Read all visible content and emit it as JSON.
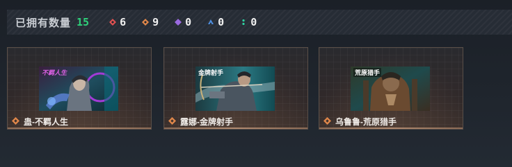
{
  "stats": {
    "label": "已拥有数量",
    "total": "15",
    "rarities": [
      {
        "icon": "red-diamond-icon",
        "color": "#e05252",
        "count": "6"
      },
      {
        "icon": "orange-diamond-icon",
        "color": "#e0874a",
        "count": "9"
      },
      {
        "icon": "purple-diamond-icon",
        "color": "#9a6ae0",
        "count": "0"
      },
      {
        "icon": "blue-triangle-icon",
        "color": "#4f8fe0",
        "count": "0"
      },
      {
        "icon": "green-dots-icon",
        "color": "#2fd0a0",
        "count": "0"
      }
    ]
  },
  "cards": [
    {
      "name": "蛊-不羁人生",
      "rarity_icon": "orange-diamond-icon",
      "image_tag": "不羁人生"
    },
    {
      "name": "露娜-金牌射手",
      "rarity_icon": "orange-diamond-icon",
      "image_tag": "金牌射手"
    },
    {
      "name": "乌鲁鲁-荒原猎手",
      "rarity_icon": "orange-diamond-icon",
      "image_tag": "荒原猎手"
    }
  ],
  "colors": {
    "accent_green": "#2fd07a",
    "card_border": "#5a4f48",
    "rarity_orange": "#e0874a"
  }
}
